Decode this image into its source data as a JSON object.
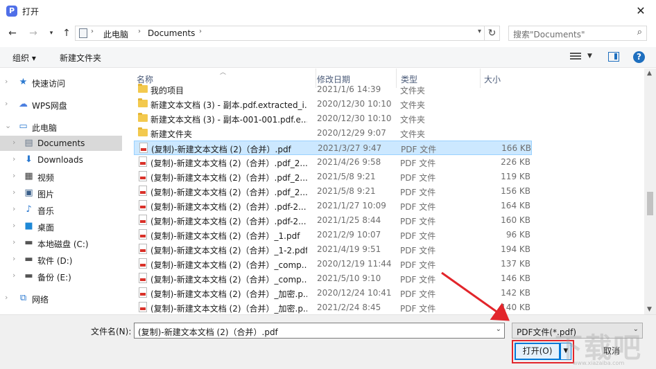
{
  "window": {
    "title": "打开",
    "app_icon_letter": "P",
    "accent_color": "#4f6fe8"
  },
  "nav": {
    "back_icon": "arrow-left-icon",
    "forward_icon": "arrow-right-icon",
    "recent_icon": "chevron-down-icon",
    "up_icon": "arrow-up-icon"
  },
  "address": {
    "path": [
      "此电脑",
      "Documents"
    ]
  },
  "search": {
    "placeholder": "搜索\"Documents\""
  },
  "toolbar": {
    "organize_label": "组织 ▾",
    "new_folder_label": "新建文件夹"
  },
  "sidebar": {
    "items": [
      {
        "label": "快速访问",
        "icon": "star-icon"
      },
      {
        "label": "WPS网盘",
        "icon": "cloud-icon"
      },
      {
        "label": "此电脑",
        "icon": "computer-icon"
      },
      {
        "label": "Documents",
        "icon": "document-icon"
      },
      {
        "label": "Downloads",
        "icon": "download-icon"
      },
      {
        "label": "视频",
        "icon": "video-icon"
      },
      {
        "label": "图片",
        "icon": "picture-icon"
      },
      {
        "label": "音乐",
        "icon": "music-icon"
      },
      {
        "label": "桌面",
        "icon": "desktop-icon"
      },
      {
        "label": "本地磁盘 (C:)",
        "icon": "drive-icon"
      },
      {
        "label": "软件 (D:)",
        "icon": "drive-icon"
      },
      {
        "label": "备份 (E:)",
        "icon": "drive-icon"
      },
      {
        "label": "网络",
        "icon": "network-icon"
      }
    ]
  },
  "columns": {
    "name": "名称",
    "date": "修改日期",
    "type": "类型",
    "size": "大小"
  },
  "files": [
    {
      "name": "我的项目",
      "date": "2021/1/6 14:39",
      "type": "文件夹",
      "size": "",
      "kind": "folder"
    },
    {
      "name": "新建文本文档 (3) - 副本.pdf.extracted_i...",
      "date": "2020/12/30 10:10",
      "type": "文件夹",
      "size": "",
      "kind": "folder"
    },
    {
      "name": "新建文本文档 (3) - 副本-001-001.pdf.e...",
      "date": "2020/12/30 10:10",
      "type": "文件夹",
      "size": "",
      "kind": "folder"
    },
    {
      "name": "新建文件夹",
      "date": "2020/12/29 9:07",
      "type": "文件夹",
      "size": "",
      "kind": "folder"
    },
    {
      "name": "(复制)-新建文本文档 (2)（合并）.pdf",
      "date": "2021/3/27 9:47",
      "type": "PDF 文件",
      "size": "166 KB",
      "kind": "pdf",
      "selected": true
    },
    {
      "name": "(复制)-新建文本文档 (2)（合并）.pdf_2...",
      "date": "2021/4/26 9:58",
      "type": "PDF 文件",
      "size": "226 KB",
      "kind": "pdf"
    },
    {
      "name": "(复制)-新建文本文档 (2)（合并）.pdf_2...",
      "date": "2021/5/8 9:21",
      "type": "PDF 文件",
      "size": "119 KB",
      "kind": "pdf"
    },
    {
      "name": "(复制)-新建文本文档 (2)（合并）.pdf_2...",
      "date": "2021/5/8 9:21",
      "type": "PDF 文件",
      "size": "156 KB",
      "kind": "pdf"
    },
    {
      "name": "(复制)-新建文本文档 (2)（合并）.pdf-2...",
      "date": "2021/1/27 10:09",
      "type": "PDF 文件",
      "size": "164 KB",
      "kind": "pdf"
    },
    {
      "name": "(复制)-新建文本文档 (2)（合并）.pdf-2...",
      "date": "2021/1/25 8:44",
      "type": "PDF 文件",
      "size": "160 KB",
      "kind": "pdf"
    },
    {
      "name": "(复制)-新建文本文档 (2)（合并）_1.pdf",
      "date": "2021/2/9 10:07",
      "type": "PDF 文件",
      "size": "96 KB",
      "kind": "pdf"
    },
    {
      "name": "(复制)-新建文本文档 (2)（合并）_1-2.pdf",
      "date": "2021/4/19 9:51",
      "type": "PDF 文件",
      "size": "194 KB",
      "kind": "pdf"
    },
    {
      "name": "(复制)-新建文本文档 (2)（合并）_comp...",
      "date": "2020/12/19 11:44",
      "type": "PDF 文件",
      "size": "137 KB",
      "kind": "pdf"
    },
    {
      "name": "(复制)-新建文本文档 (2)（合并）_comp...",
      "date": "2021/5/10 9:10",
      "type": "PDF 文件",
      "size": "146 KB",
      "kind": "pdf"
    },
    {
      "name": "(复制)-新建文本文档 (2)（合并）_加密.p...",
      "date": "2020/12/24 10:41",
      "type": "PDF 文件",
      "size": "142 KB",
      "kind": "pdf"
    },
    {
      "name": "(复制)-新建文本文档 (2)（合并）_加密.p...",
      "date": "2021/2/24 8:45",
      "type": "PDF 文件",
      "size": "140 KB",
      "kind": "pdf"
    }
  ],
  "bottom": {
    "filename_label": "文件名(N):",
    "filename_value": "(复制)-新建文本文档 (2)（合并）.pdf",
    "filter_value": "PDF文件(*.pdf)",
    "open_label": "打开(O)",
    "cancel_label": "取消"
  },
  "annotation": {
    "color": "#e2252b"
  },
  "watermark": {
    "text": "下载吧",
    "url": "www.xiazaiba.com"
  }
}
